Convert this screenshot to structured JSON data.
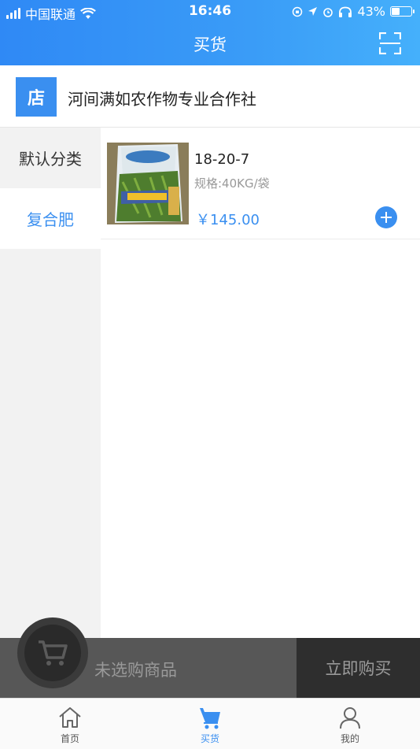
{
  "status": {
    "carrier": "中国联通",
    "time": "16:46",
    "battery": "43%",
    "battery_level": 0.43
  },
  "header": {
    "title": "买货"
  },
  "shop": {
    "badge": "店",
    "name": "河间满如农作物专业合作社"
  },
  "sidebar": {
    "items": [
      {
        "label": "默认分类"
      },
      {
        "label": "复合肥"
      }
    ]
  },
  "products": [
    {
      "name": "18-20-7",
      "spec": "规格:40KG/袋",
      "price": "￥145.00"
    }
  ],
  "cart": {
    "empty_text": "未选购商品",
    "buy_label": "立即购买"
  },
  "tabs": [
    {
      "label": "首页"
    },
    {
      "label": "买货"
    },
    {
      "label": "我的"
    }
  ],
  "colors": {
    "accent": "#3a8ff0"
  }
}
